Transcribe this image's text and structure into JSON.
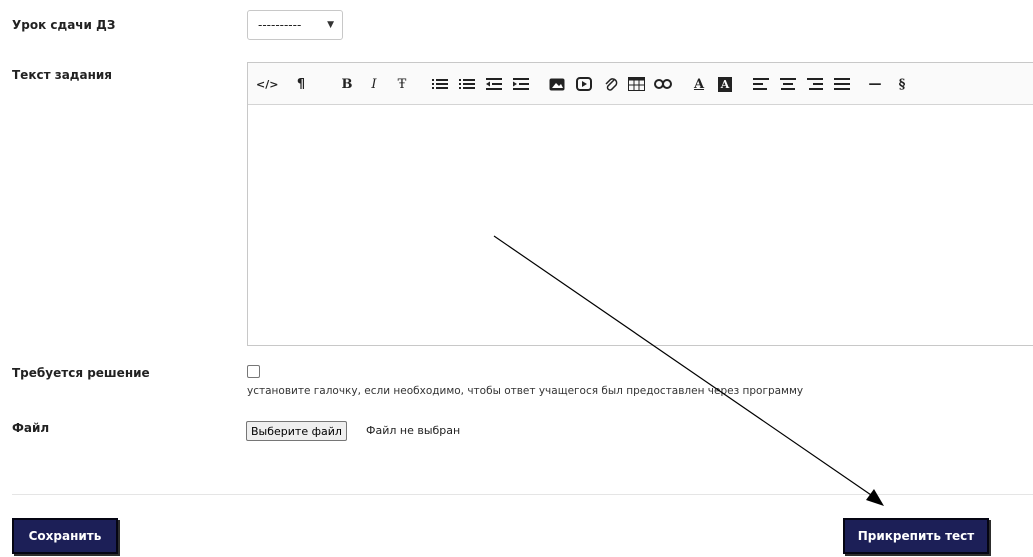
{
  "form": {
    "lesson_label": "Урок сдачи ДЗ",
    "lesson_value": "----------",
    "task_label": "Текст задания",
    "requires_label": "Требуется решение",
    "requires_hint": "установите галочку, если необходимо, чтобы ответ учащегося был предоставлен через программу",
    "file_label": "Файл",
    "file_button": "Выберите файл",
    "file_status": "Файл не выбран"
  },
  "toolbar": {
    "items": [
      {
        "name": "html-code-icon",
        "glyph": "</>"
      },
      {
        "name": "paragraph-format-icon",
        "glyph": "¶"
      },
      {
        "name": "bold-icon",
        "glyph": "B"
      },
      {
        "name": "italic-icon",
        "glyph": "I"
      },
      {
        "name": "strikethrough-icon",
        "glyph": "Ŧ"
      },
      {
        "name": "unordered-list-icon",
        "glyph": "list"
      },
      {
        "name": "ordered-list-icon",
        "glyph": "olist"
      },
      {
        "name": "outdent-icon",
        "glyph": "outdent"
      },
      {
        "name": "indent-icon",
        "glyph": "indent"
      },
      {
        "name": "image-icon",
        "glyph": "image"
      },
      {
        "name": "video-icon",
        "glyph": "video"
      },
      {
        "name": "attachment-icon",
        "glyph": "clip"
      },
      {
        "name": "table-icon",
        "glyph": "table"
      },
      {
        "name": "link-icon",
        "glyph": "link"
      },
      {
        "name": "font-color-icon",
        "glyph": "A"
      },
      {
        "name": "background-color-icon",
        "glyph": "A"
      },
      {
        "name": "align-left-icon",
        "glyph": "align-left"
      },
      {
        "name": "align-center-icon",
        "glyph": "align-center"
      },
      {
        "name": "align-right-icon",
        "glyph": "align-right"
      },
      {
        "name": "align-justify-icon",
        "glyph": "align-justify"
      },
      {
        "name": "horizontal-rule-icon",
        "glyph": "—"
      },
      {
        "name": "section-sign-icon",
        "glyph": "§"
      }
    ]
  },
  "actions": {
    "save_label": "Сохранить",
    "attach_test_label": "Прикрепить тест"
  },
  "colors": {
    "button_bg": "#1c1f57",
    "button_border": "#050513"
  }
}
